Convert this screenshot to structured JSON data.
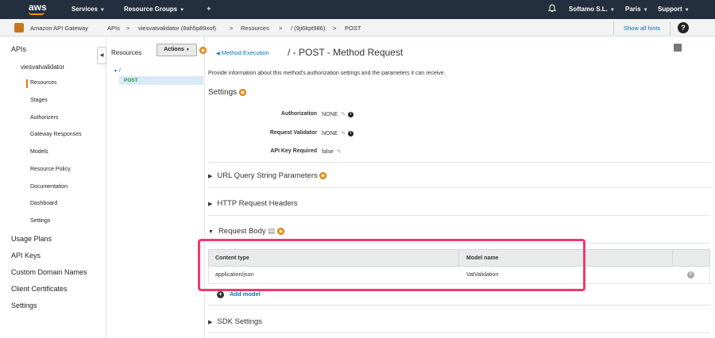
{
  "topbar": {
    "logo": "aws",
    "services": "Services",
    "resource_groups": "Resource Groups",
    "account": "Softamo S.L.",
    "region": "Paris",
    "support": "Support"
  },
  "breadcrumb": {
    "service": "Amazon API Gateway",
    "apis": "APIs",
    "sep": ">",
    "api": "viesvatvalidator (8ah5p89xof)",
    "resources": "Resources",
    "resource": "/ (9ji6kpt986)",
    "method": "POST",
    "show_hints": "Show all hints",
    "help": "?"
  },
  "left_nav": {
    "apis": "APIs",
    "api_name": "viesvatvalidator",
    "items": [
      "Resources",
      "Stages",
      "Authorizers",
      "Gateway Responses",
      "Models",
      "Resource Policy",
      "Documentation",
      "Dashboard",
      "Settings"
    ],
    "bottom": [
      "Usage Plans",
      "API Keys",
      "Custom Domain Names",
      "Client Certificates",
      "Settings"
    ]
  },
  "resources_panel": {
    "title": "Resources",
    "actions": "Actions",
    "root": "/",
    "post": "POST"
  },
  "main": {
    "back_link": "Method Execution",
    "title": "/ - POST - Method Request",
    "description": "Provide information about this method's authorization settings and the parameters it can receive.",
    "settings_heading": "Settings",
    "authorization_label": "Authorization",
    "authorization_value": "NONE",
    "validator_label": "Request Validator",
    "validator_value": "NONE",
    "apikey_label": "API Key Required",
    "apikey_value": "false",
    "sections": {
      "url_query": "URL Query String Parameters",
      "http_headers": "HTTP Request Headers",
      "request_body": "Request Body",
      "sdk_settings": "SDK Settings"
    },
    "table": {
      "headers": [
        "Content type",
        "Model name"
      ],
      "rows": [
        [
          "application/json",
          "VatValidation"
        ]
      ]
    },
    "add_model": "Add model"
  },
  "colors": {
    "topbar": "#232f3e",
    "accent": "#ff9900",
    "link": "#0073bb",
    "highlight": "#f0396e"
  }
}
